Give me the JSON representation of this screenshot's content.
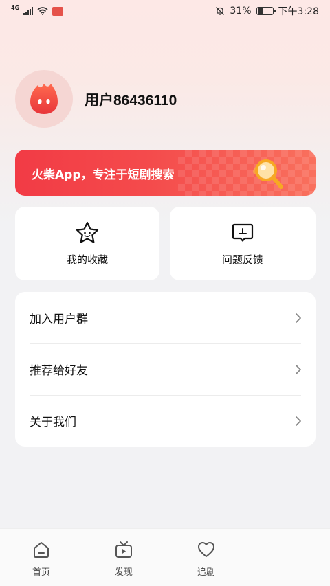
{
  "status_bar": {
    "network": "4G",
    "battery_percent": "31%",
    "time": "下午3:28"
  },
  "profile": {
    "username": "用户86436110"
  },
  "banner": {
    "text": "火柴App，专注于短剧搜索"
  },
  "quick_actions": [
    {
      "label": "我的收藏",
      "icon": "star-face-icon"
    },
    {
      "label": "问题反馈",
      "icon": "feedback-icon"
    }
  ],
  "menu": {
    "items": [
      {
        "label": "加入用户群"
      },
      {
        "label": "推荐给好友"
      },
      {
        "label": "关于我们"
      }
    ]
  },
  "tabbar": {
    "tabs": [
      {
        "label": "首页",
        "icon": "home-icon"
      },
      {
        "label": "发现",
        "icon": "tv-play-icon"
      },
      {
        "label": "追剧",
        "icon": "heart-icon"
      }
    ]
  },
  "colors": {
    "accent": "#f23b45",
    "banner_end": "#f9705d",
    "avatar_bg": "#f5d6d3"
  }
}
